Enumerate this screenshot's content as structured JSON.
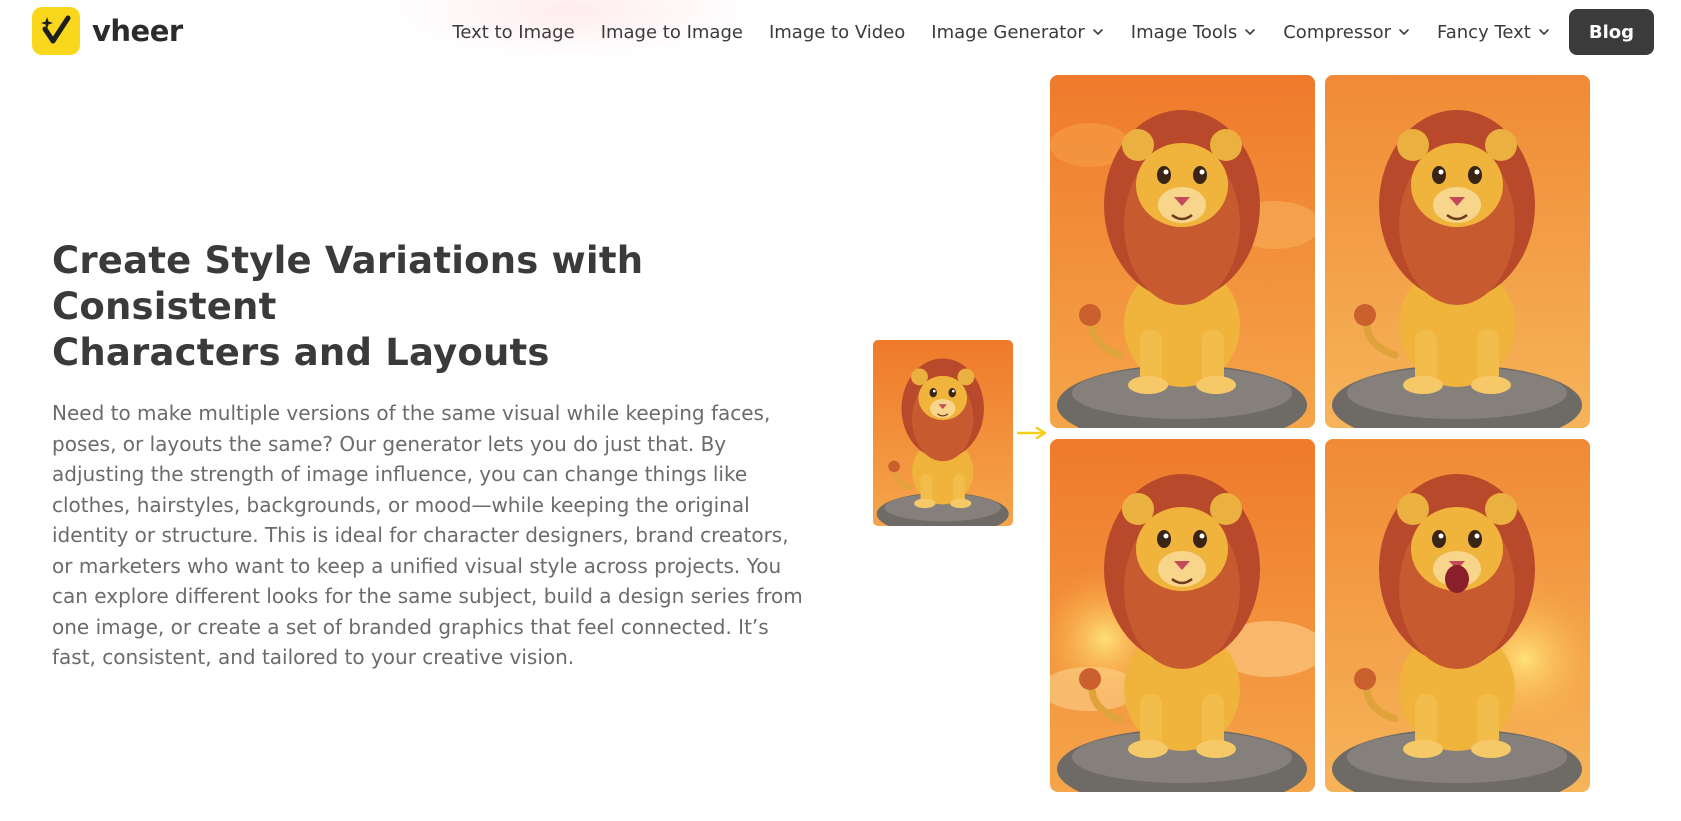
{
  "brand": {
    "name": "vheer",
    "accent_color": "#f9d71c",
    "logo_icon": "sparkle-check-icon"
  },
  "nav": {
    "items": [
      {
        "label": "Text to Image",
        "dropdown": false
      },
      {
        "label": "Image to Image",
        "dropdown": false
      },
      {
        "label": "Image to Video",
        "dropdown": false
      },
      {
        "label": "Image Generator",
        "dropdown": true
      },
      {
        "label": "Image Tools",
        "dropdown": true
      },
      {
        "label": "Compressor",
        "dropdown": true
      },
      {
        "label": "Fancy Text",
        "dropdown": true
      }
    ],
    "blog_label": "Blog"
  },
  "section": {
    "title_line1": "Create Style Variations with Consistent",
    "title_line2": "Characters and Layouts",
    "description": "Need to make multiple versions of the same visual while keeping faces, poses, or layouts the same? Our generator lets you do just that. By adjusting the strength of image influence, you can change things like clothes, hairstyles, backgrounds, or mood—while keeping the original identity or structure. This is ideal for character designers, brand creators, or marketers who want to keep a unified visual style across projects. You can explore different looks for the same subject, build a design series from one image, or create a set of branded graphics that feel connected. It’s fast, consistent, and tailored to your creative vision."
  },
  "images": {
    "source": "cartoon lion on rock (source)",
    "arrow_color": "#f3cf1a",
    "variations": [
      "cartoon lion variation 1",
      "cartoon lion variation 2",
      "cartoon lion variation 3",
      "cartoon lion variation 4"
    ]
  }
}
